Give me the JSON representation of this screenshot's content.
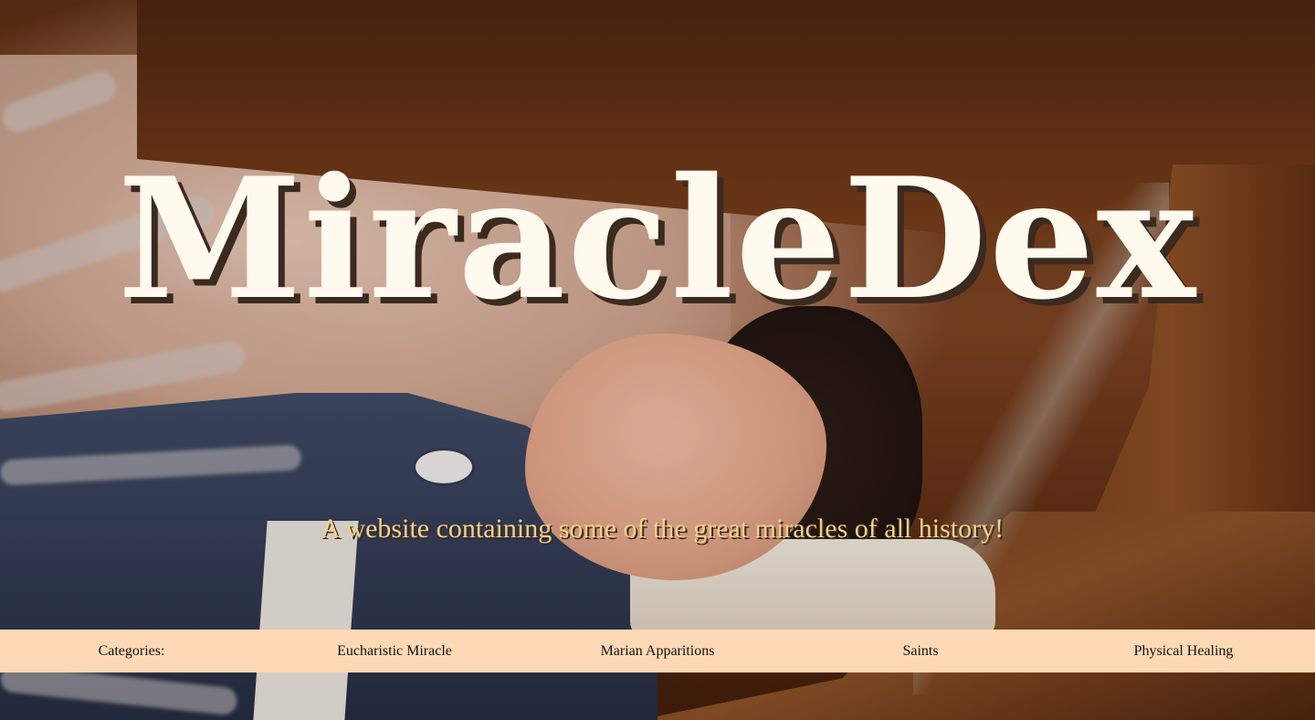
{
  "site": {
    "title": "MiracleDex",
    "tagline": "A website containing some of the great miracles of all history!"
  },
  "nav": {
    "categories_label": "Categories:",
    "items": [
      {
        "label": "Eucharistic Miracle"
      },
      {
        "label": "Marian Apparitions"
      },
      {
        "label": "Saints"
      },
      {
        "label": "Physical Healing"
      }
    ]
  },
  "colors": {
    "title": "#fff9ee",
    "tagline": "#f1d08a",
    "nav_background": "#ffd9b5"
  }
}
